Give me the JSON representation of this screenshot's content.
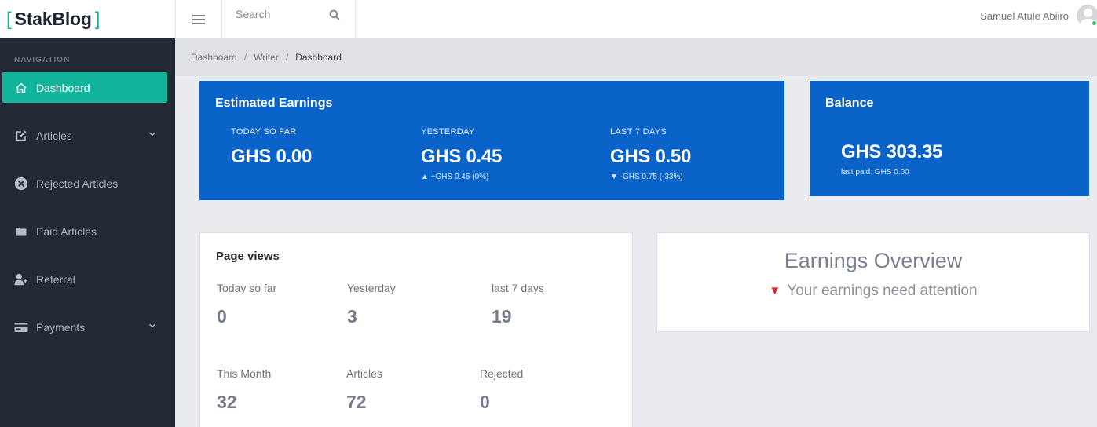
{
  "brand": {
    "bracket_open": "[",
    "name": "StakBlog",
    "bracket_close": "]"
  },
  "header": {
    "search_placeholder": "Search",
    "user_name": "Samuel Atule Abiiro"
  },
  "sidebar": {
    "heading": "NAVIGATION",
    "items": [
      {
        "label": "Dashboard",
        "icon": "home-icon"
      },
      {
        "label": "Articles",
        "icon": "edit-icon"
      },
      {
        "label": "Rejected Articles",
        "icon": "x-circle-icon"
      },
      {
        "label": "Paid Articles",
        "icon": "folder-icon"
      },
      {
        "label": "Referral",
        "icon": "user-plus-icon"
      },
      {
        "label": "Payments",
        "icon": "credit-card-icon"
      }
    ]
  },
  "breadcrumb": {
    "items": [
      "Dashboard",
      "Writer",
      "Dashboard"
    ],
    "separator": "/"
  },
  "earnings": {
    "title": "Estimated Earnings",
    "today": {
      "label": "TODAY SO FAR",
      "value": "GHS 0.00"
    },
    "yesterday": {
      "label": "YESTERDAY",
      "value": "GHS 0.45",
      "change": "▲ +GHS 0.45 (0%)"
    },
    "last7": {
      "label": "LAST 7 DAYS",
      "value": "GHS 0.50",
      "change": "▼ -GHS 0.75 (-33%)"
    }
  },
  "balance": {
    "title": "Balance",
    "value": "GHS 303.35",
    "last_paid": "last paid: GHS 0.00"
  },
  "page_views": {
    "title": "Page views",
    "stats": [
      {
        "label": "Today so far",
        "value": "0"
      },
      {
        "label": "Yesterday",
        "value": "3"
      },
      {
        "label": "last 7 days",
        "value": "19"
      },
      {
        "label": "This Month",
        "value": "32"
      },
      {
        "label": "Articles",
        "value": "72"
      },
      {
        "label": "Rejected",
        "value": "0"
      }
    ]
  },
  "overview": {
    "title": "Earnings Overview",
    "indicator": "▼",
    "message": "Your earnings need attention"
  },
  "colors": {
    "accent": "#12b39b",
    "sidebar": "#222a35",
    "card_blue": "#0a63c9",
    "alert": "#e22525"
  }
}
